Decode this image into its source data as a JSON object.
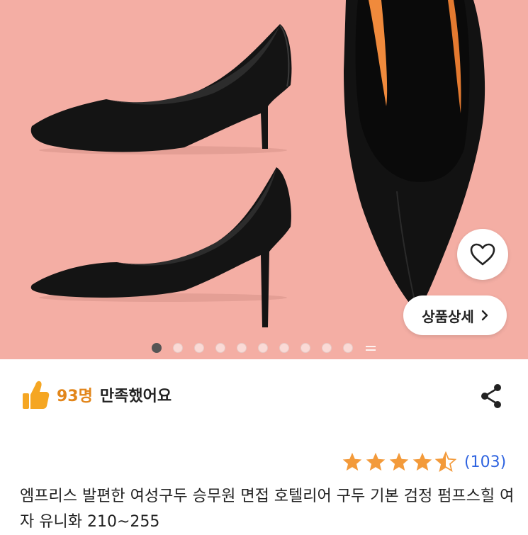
{
  "hero": {
    "background": "#f4aea4",
    "carousel_total": 10,
    "carousel_active": 0,
    "more_icon": "menu-lines-icon"
  },
  "buttons": {
    "wishlist_icon": "heart-icon",
    "detail_label": "상품상세",
    "detail_icon": "chevron-right-icon",
    "share_icon": "share-icon"
  },
  "satisfaction": {
    "icon": "thumbs-up-icon",
    "count": "93명",
    "text": "만족했어요",
    "accent": "#e2861b"
  },
  "rating": {
    "stars": 4.5,
    "max": 5,
    "star_color": "#f39a3a",
    "review_count": "(103)",
    "link_color": "#2f64e0"
  },
  "product": {
    "title": "엠프리스 발편한 여성구두 승무원 면접 호텔리어 구두 기본 검정 펌프스힐 여자 유니화 210~255"
  }
}
